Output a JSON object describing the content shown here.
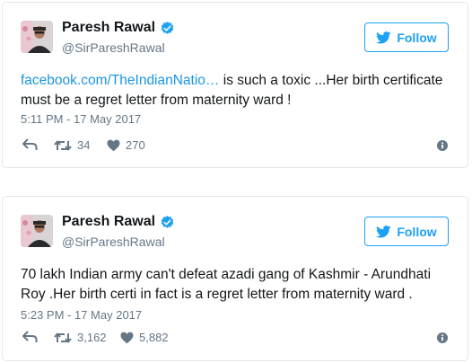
{
  "colors": {
    "accent": "#1da1f2",
    "link": "#1b95e0",
    "muted": "#657786",
    "border": "#e1e8ed"
  },
  "tweets": [
    {
      "author": "Paresh Rawal",
      "handle": "@SirPareshRawal",
      "follow_label": "Follow",
      "link_text": "facebook.com/TheIndianNatio…",
      "text": " is such a toxic ...Her birth certificate must be a regret letter from maternity ward !",
      "timestamp": "5:11 PM - 17 May 2017",
      "retweets": "34",
      "likes": "270"
    },
    {
      "author": "Paresh Rawal",
      "handle": "@SirPareshRawal",
      "follow_label": "Follow",
      "link_text": "",
      "text": "70 lakh Indian army can't defeat azadi gang of Kashmir - Arundhati Roy .Her birth certi in fact is a regret letter from maternity ward .",
      "timestamp": "5:23 PM - 17 May 2017",
      "retweets": "3,162",
      "likes": "5,882"
    }
  ]
}
